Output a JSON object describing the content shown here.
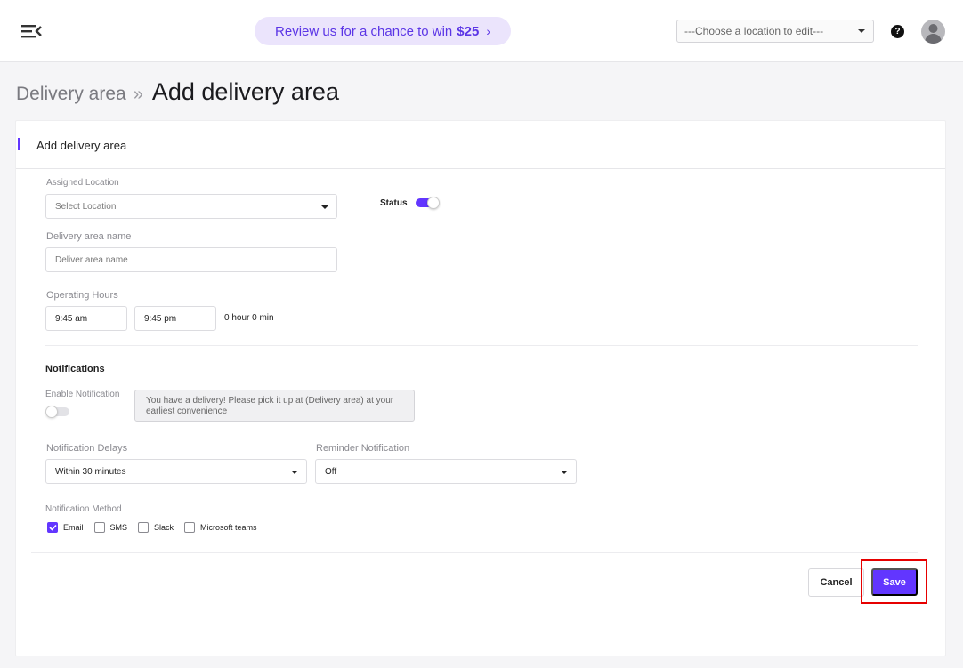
{
  "header": {
    "promo": {
      "text": "Review us for a chance to win",
      "amount": "$25",
      "chevron": "›"
    },
    "location_select": {
      "placeholder": "---Choose a location to edit---"
    },
    "help_symbol": "?"
  },
  "breadcrumb": {
    "parent": "Delivery area",
    "separator": "»",
    "current": "Add delivery area"
  },
  "card": {
    "title": "Add delivery area"
  },
  "form": {
    "assigned_location": {
      "label": "Assigned Location",
      "placeholder": "Select Location"
    },
    "status": {
      "label": "Status",
      "enabled": true
    },
    "delivery_area_name": {
      "label": "Delivery area name",
      "placeholder": "Deliver area name"
    },
    "operating_hours": {
      "label": "Operating Hours",
      "start": "9:45 am",
      "end": "9:45 pm",
      "duration": "0 hour  0 min"
    }
  },
  "notifications": {
    "title": "Notifications",
    "enable_label": "Enable Notification",
    "enabled": false,
    "message": "You have a delivery! Please pick it up at (Delivery area) at your earliest convenience",
    "delays": {
      "label": "Notification Delays",
      "value": "Within 30 minutes"
    },
    "reminder": {
      "label": "Reminder Notification",
      "value": "Off"
    },
    "method": {
      "label": "Notification Method",
      "options": [
        {
          "label": "Email",
          "checked": true
        },
        {
          "label": "SMS",
          "checked": false
        },
        {
          "label": "Slack",
          "checked": false
        },
        {
          "label": "Microsoft teams",
          "checked": false
        }
      ]
    }
  },
  "actions": {
    "cancel": "Cancel",
    "save": "Save"
  },
  "colors": {
    "accent": "#6236ff",
    "promo_bg": "#ebe4fc",
    "highlight": "#e60000"
  },
  "icons": [
    "menu-collapse-icon",
    "chevron-right-icon",
    "caret-down-icon",
    "help-icon",
    "avatar-icon",
    "check-icon"
  ]
}
